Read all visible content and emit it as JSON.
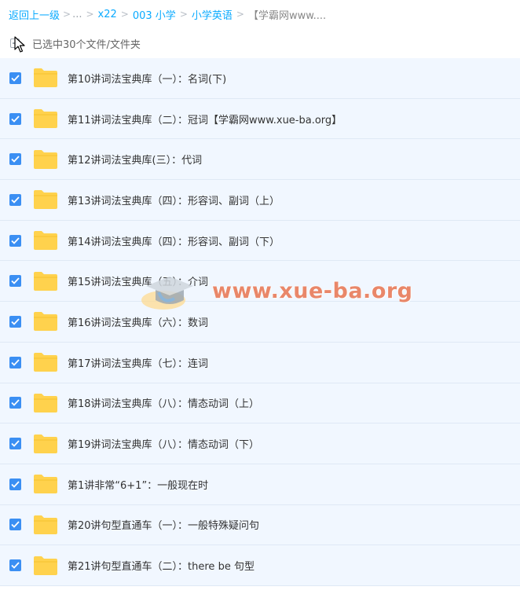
{
  "breadcrumb": {
    "back": "返回上一级",
    "ellipsis": "...",
    "seps": [
      ">",
      ">",
      ">",
      ">"
    ],
    "items": [
      "x22",
      "003 小学",
      "小学英语"
    ],
    "current": "【学霸网www...."
  },
  "selection": {
    "label": "已选中30个文件/文件夹"
  },
  "colors": {
    "accent": "#09aaff",
    "checkbox": "#3b8ff3",
    "row_bg": "#f1f7ff",
    "folder": "#ffd24d"
  },
  "folders": [
    {
      "name": "第10讲词法宝典库（一）：名词(下)",
      "checked": true
    },
    {
      "name": "第11讲词法宝典库（二）：冠词【学霸网www.xue-ba.org】",
      "checked": true
    },
    {
      "name": "第12讲词法宝典库(三）：代词",
      "checked": true
    },
    {
      "name": "第13讲词法宝典库（四）：形容词、副词（上）",
      "checked": true
    },
    {
      "name": "第14讲词法宝典库（四）：形容词、副词（下）",
      "checked": true
    },
    {
      "name": "第15讲词法宝典库（五）：介词",
      "checked": true
    },
    {
      "name": "第16讲词法宝典库（六）：数词",
      "checked": true
    },
    {
      "name": "第17讲词法宝典库（七）：连词",
      "checked": true
    },
    {
      "name": "第18讲词法宝典库（八）：情态动词（上）",
      "checked": true
    },
    {
      "name": "第19讲词法宝典库（八）：情态动词（下）",
      "checked": true
    },
    {
      "name": "第1讲非常“6+1”：一般现在时",
      "checked": true
    },
    {
      "name": "第20讲句型直通车（一）：一般特殊疑问句",
      "checked": true
    },
    {
      "name": "第21讲句型直通车（二）：there be 句型",
      "checked": true
    }
  ],
  "watermark": {
    "text": "www.xue-ba.org"
  }
}
